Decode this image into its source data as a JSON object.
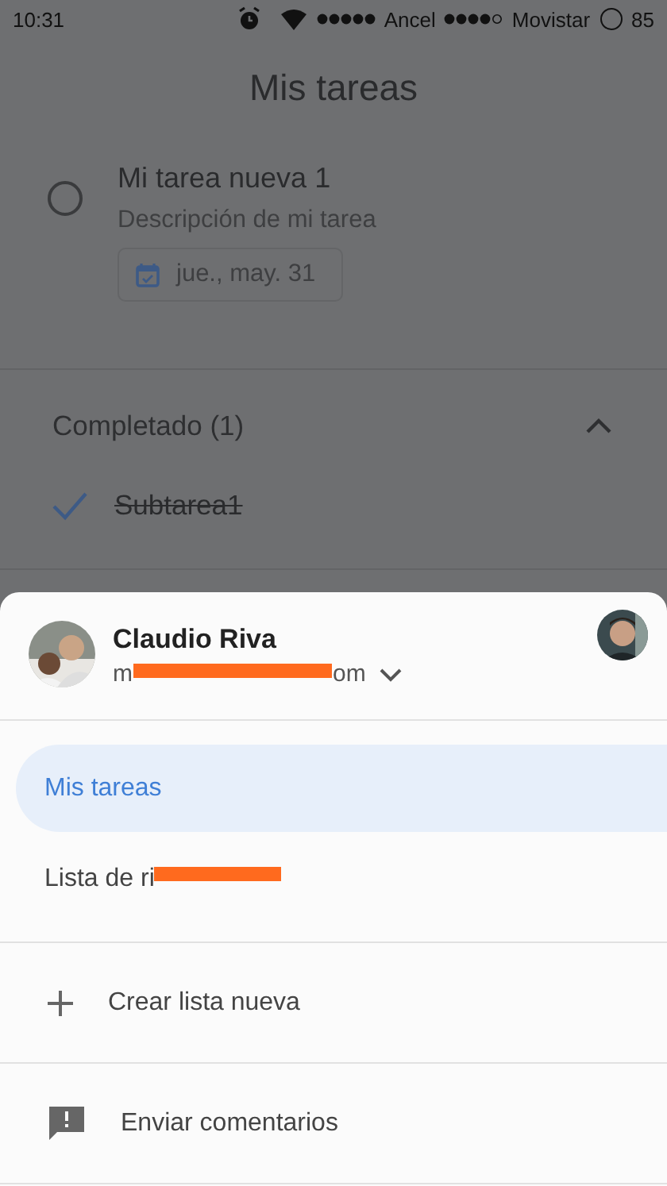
{
  "status_bar": {
    "time": "10:31",
    "carriers": [
      {
        "name": "Ancel",
        "signal_full": true
      },
      {
        "name": "Movistar",
        "signal_full": false
      }
    ],
    "battery": "85"
  },
  "header": {
    "title": "Mis tareas"
  },
  "tasks": [
    {
      "title": "Mi tarea nueva 1",
      "description": "Descripción de mi tarea",
      "due": "jue., may. 31",
      "completed": false
    }
  ],
  "completed_section": {
    "label": "Completado (1)",
    "expanded": true,
    "tasks": [
      {
        "title": "Subtarea1",
        "completed": true
      }
    ]
  },
  "account_sheet": {
    "name": "Claudio Riva",
    "email_start": "m",
    "email_end": "om",
    "lists": [
      {
        "label": "Mis tareas",
        "redacted": false,
        "selected": true
      },
      {
        "label": "Lista de ri",
        "redacted": true,
        "selected": false
      }
    ],
    "actions": [
      {
        "kind": "add",
        "label": "Crear lista nueva"
      },
      {
        "kind": "feedback",
        "label": "Enviar comentarios"
      }
    ]
  }
}
